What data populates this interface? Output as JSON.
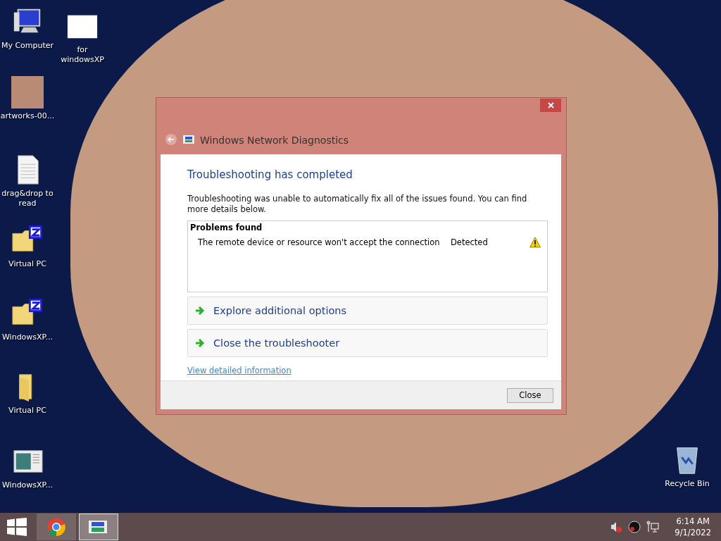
{
  "desktop_icons": [
    {
      "label": "My Computer",
      "kind": "computer"
    },
    {
      "label": "for windowsXP",
      "kind": "blank"
    },
    {
      "label": "artworks-00...",
      "kind": "photo"
    },
    {
      "label": "drag&drop to read",
      "kind": "document"
    },
    {
      "label": "Virtual PC",
      "kind": "zfolder"
    },
    {
      "label": "WindowsXP...",
      "kind": "zfolder"
    },
    {
      "label": "Virtual PC",
      "kind": "folder"
    },
    {
      "label": "WindowsXP...",
      "kind": "app"
    },
    {
      "label": "Recycle Bin",
      "kind": "recycle"
    }
  ],
  "dialog": {
    "title": "Windows Network Diagnostics",
    "heading": "Troubleshooting has completed",
    "message": "Troubleshooting was unable to automatically fix all of the issues found. You can find more details below.",
    "problems": {
      "header": "Problems found",
      "rows": [
        {
          "problem": "The remote device or resource won't accept the connection",
          "status": "Detected"
        }
      ]
    },
    "options": [
      {
        "label": "Explore additional options"
      },
      {
        "label": "Close the troubleshooter"
      }
    ],
    "link": "View detailed information",
    "buttons": [
      "Close"
    ]
  },
  "taskbar": {
    "apps": [
      {
        "kind": "browser",
        "selected": false
      },
      {
        "kind": "app",
        "selected": true
      }
    ],
    "tray": [
      {
        "kind": "volume-muted"
      },
      {
        "kind": "record"
      },
      {
        "kind": "network"
      }
    ],
    "clock": {
      "time": "6:14 AM",
      "date": "9/1/2022"
    }
  }
}
